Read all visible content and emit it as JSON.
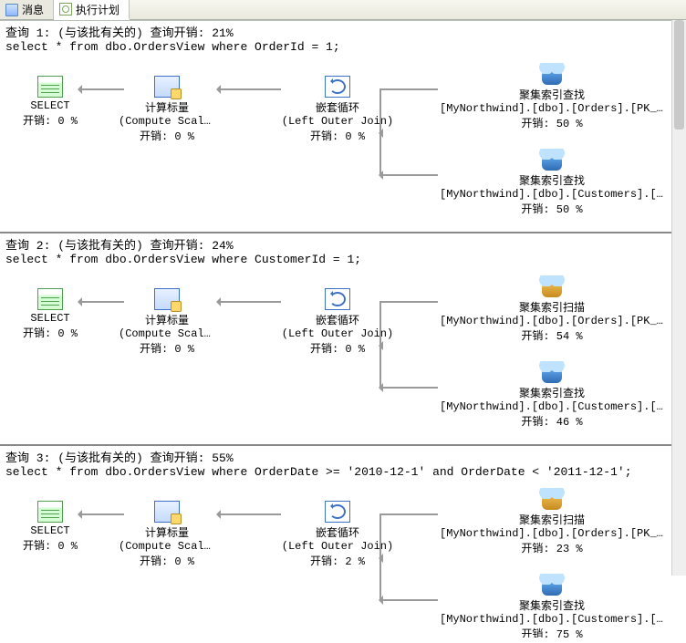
{
  "tabs": {
    "messages": "消息",
    "plan": "执行计划"
  },
  "cost_label_prefix": "开销: ",
  "queries": [
    {
      "header": "查询 1: (与该批有关的) 查询开销: 21%",
      "sql": "select * from dbo.OrdersView where OrderId = 1;",
      "ops": {
        "select": {
          "title": "SELECT",
          "sub": "",
          "cost": "0 %"
        },
        "compute": {
          "title": "计算标量",
          "sub": "(Compute Scalar)",
          "cost": "0 %"
        },
        "loop": {
          "title": "嵌套循环",
          "sub": "(Left Outer Join)",
          "cost": "0 %"
        },
        "top": {
          "title": "聚集索引查找",
          "sub": "[MyNorthwind].[dbo].[Orders].[PK_Or…",
          "cost": "50 %",
          "variant": "seek"
        },
        "bot": {
          "title": "聚集索引查找",
          "sub": "[MyNorthwind].[dbo].[Customers].[PK…",
          "cost": "50 %",
          "variant": "seek"
        }
      }
    },
    {
      "header": "查询 2: (与该批有关的) 查询开销: 24%",
      "sql": "select * from dbo.OrdersView where CustomerId = 1;",
      "ops": {
        "select": {
          "title": "SELECT",
          "sub": "",
          "cost": "0 %"
        },
        "compute": {
          "title": "计算标量",
          "sub": "(Compute Scalar)",
          "cost": "0 %"
        },
        "loop": {
          "title": "嵌套循环",
          "sub": "(Left Outer Join)",
          "cost": "0 %"
        },
        "top": {
          "title": "聚集索引扫描",
          "sub": "[MyNorthwind].[dbo].[Orders].[PK_Or…",
          "cost": "54 %",
          "variant": "scan"
        },
        "bot": {
          "title": "聚集索引查找",
          "sub": "[MyNorthwind].[dbo].[Customers].[PK…",
          "cost": "46 %",
          "variant": "seek"
        }
      }
    },
    {
      "header": "查询 3: (与该批有关的) 查询开销: 55%",
      "sql": "select * from dbo.OrdersView where OrderDate >= '2010-12-1' and OrderDate < '2011-12-1';",
      "ops": {
        "select": {
          "title": "SELECT",
          "sub": "",
          "cost": "0 %"
        },
        "compute": {
          "title": "计算标量",
          "sub": "(Compute Scalar)",
          "cost": "0 %"
        },
        "loop": {
          "title": "嵌套循环",
          "sub": "(Left Outer Join)",
          "cost": "2 %"
        },
        "top": {
          "title": "聚集索引扫描",
          "sub": "[MyNorthwind].[dbo].[Orders].[PK_Or…",
          "cost": "23 %",
          "variant": "scan"
        },
        "bot": {
          "title": "聚集索引查找",
          "sub": "[MyNorthwind].[dbo].[Customers].[PK…",
          "cost": "75 %",
          "variant": "seek"
        }
      }
    }
  ]
}
